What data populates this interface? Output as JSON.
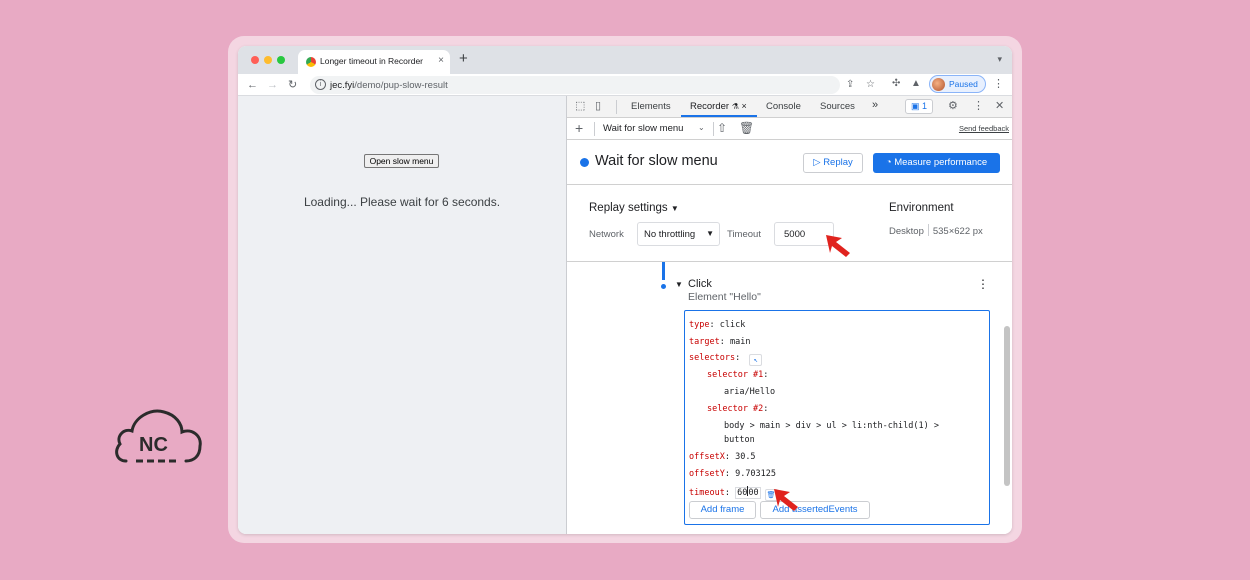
{
  "browser": {
    "tab_title": "Longer timeout in Recorder",
    "tab_close": "×",
    "new_tab": "+",
    "strip_chevron": "⌄",
    "url_host": "jec.fyi",
    "url_path": "/demo/pup-slow-result",
    "profile_status": "Paused",
    "nav_icons": [
      "back-icon",
      "forward-icon",
      "reload-icon"
    ]
  },
  "page": {
    "button_label": "Open slow menu",
    "loading_text": "Loading... Please wait for 6 seconds."
  },
  "devtools": {
    "tabs": [
      "Elements",
      "Recorder",
      "Console",
      "Sources"
    ],
    "active_tab": "Recorder",
    "more_tabs": "»",
    "issues_count": "1",
    "toolbar": {
      "recording_select": "Wait for slow menu",
      "send_feedback": "Send feedback"
    },
    "recording": {
      "title": "Wait for slow menu",
      "replay_label": "Replay",
      "measure_label": "Measure performance"
    },
    "replay_settings": {
      "title": "Replay settings",
      "network_label": "Network",
      "network_value": "No throttling",
      "timeout_label": "Timeout",
      "timeout_value": "5000",
      "environment_title": "Environment",
      "environment_device": "Desktop",
      "environment_size": "535×622 px"
    },
    "step": {
      "name": "Click",
      "subtitle": "Element \"Hello\"",
      "code": {
        "type_key": "type",
        "type_val": "click",
        "target_key": "target",
        "target_val": "main",
        "selectors_key": "selectors",
        "selector1_key": "selector #1",
        "selector1_val": "aria/Hello",
        "selector2_key": "selector #2",
        "selector2_val_line1": "body > main > div > ul > li:nth-child(1) >",
        "selector2_val_line2": "button",
        "offsetx_key": "offsetX",
        "offsetx_val": "30.5",
        "offsety_key": "offsetY",
        "offsety_val": "9.703125",
        "timeout_key": "timeout",
        "timeout_val_a": "60",
        "timeout_val_b": "00"
      },
      "add_frame_label": "Add frame",
      "add_asserted_label": "Add assertedEvents"
    }
  },
  "logo": {
    "text": "NC"
  },
  "colors": {
    "background": "#e8aac4",
    "accent": "#1a73e8",
    "annotation_arrow": "#e0231e"
  }
}
